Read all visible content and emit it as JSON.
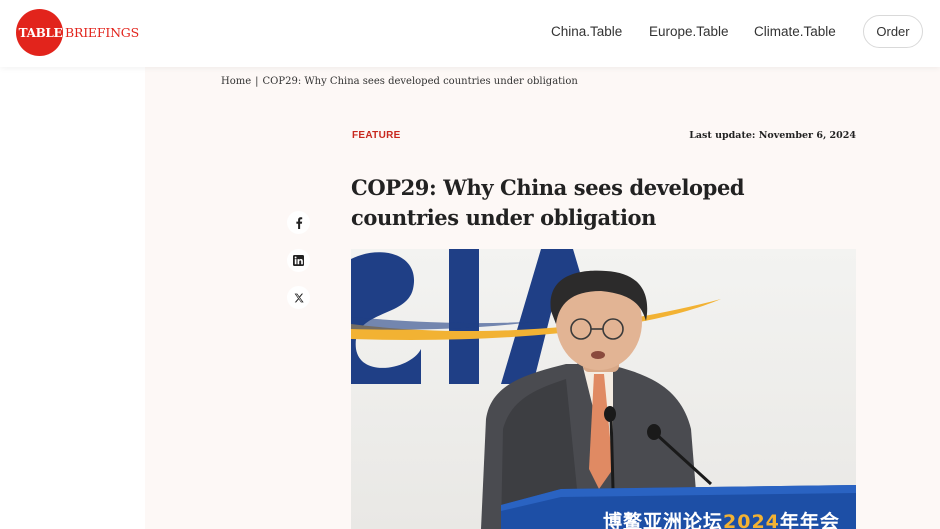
{
  "header": {
    "logo": {
      "table": "TABLE",
      "briefings": "BRIEFINGS"
    },
    "nav": [
      {
        "label": "China.Table"
      },
      {
        "label": "Europe.Table"
      },
      {
        "label": "Climate.Table"
      }
    ],
    "order_label": "Order"
  },
  "breadcrumb": {
    "home": "Home",
    "separator": "|",
    "current": "COP29: Why China sees developed countries under obligation"
  },
  "article": {
    "category": "FEATURE",
    "last_update": "Last update: November 6, 2024",
    "title": "COP29: Why China sees developed countries under obligation",
    "image_podium_text": "博鳌亚洲论坛",
    "image_podium_year": "2024",
    "image_podium_suffix": "年年会"
  },
  "share": {
    "icons": [
      "facebook-icon",
      "linkedin-icon",
      "x-icon"
    ]
  },
  "colors": {
    "brand_red": "#e2241c",
    "feature_red": "#c8281e",
    "content_bg": "#fdf8f6",
    "text": "#222222"
  }
}
